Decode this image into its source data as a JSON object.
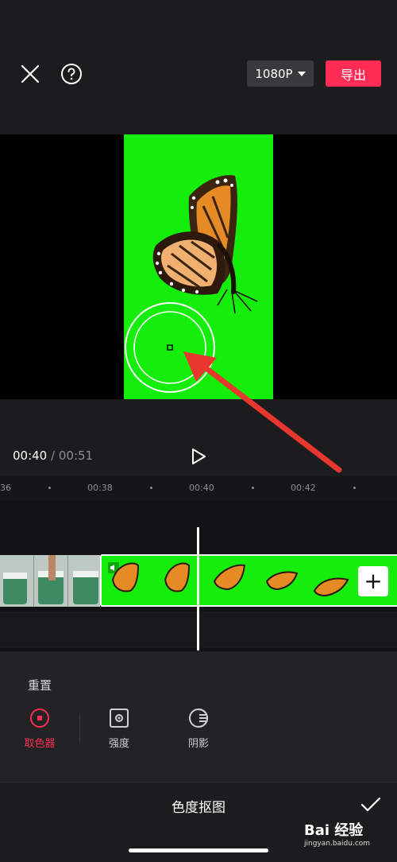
{
  "topbar": {
    "close_icon": "close-icon",
    "help_icon": "help-icon",
    "resolution": "1080P",
    "export_label": "导出"
  },
  "preview": {
    "bg_color": "#14ee0a"
  },
  "playback": {
    "current_time": "00:40",
    "separator": "/",
    "total_time": "00:51"
  },
  "ruler": {
    "ticks": [
      "36",
      "00:38",
      "00:40",
      "00:42"
    ]
  },
  "timeline": {
    "add_label": "+"
  },
  "panel": {
    "reset_label": "重置",
    "tools": [
      {
        "label": "取色器",
        "icon": "color-picker-icon",
        "active": true
      },
      {
        "label": "强度",
        "icon": "intensity-icon",
        "active": false
      },
      {
        "label": "阴影",
        "icon": "shadow-icon",
        "active": false
      }
    ],
    "title": "色度抠图",
    "confirm_icon": "check-icon"
  },
  "watermark": {
    "brand": "Bai 经验",
    "url": "jingyan.baidu.com"
  },
  "colors": {
    "accent": "#fe2c55",
    "chroma_green": "#14ee0a",
    "arrow": "#e8372f"
  }
}
